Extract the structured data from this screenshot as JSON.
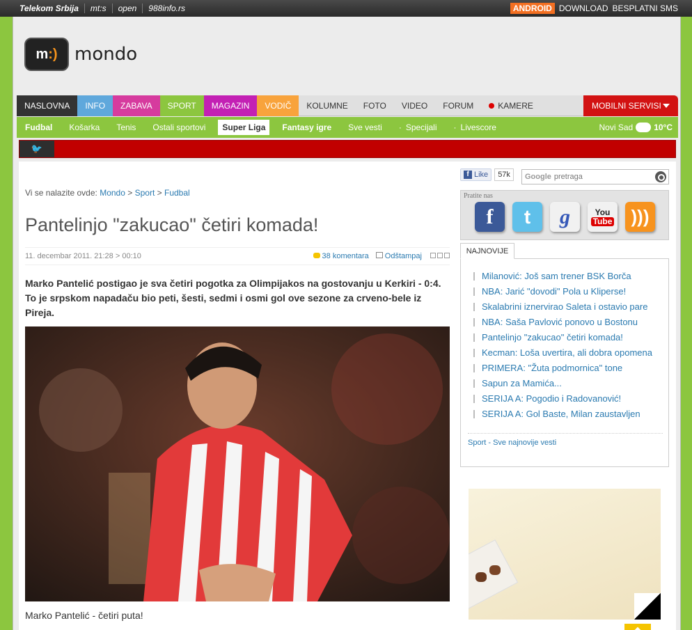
{
  "topbar": {
    "links": [
      "Telekom Srbija",
      "mt:s",
      "open",
      "988info.rs"
    ],
    "android_label": "ANDROID",
    "download_label": "DOWNLOAD",
    "sms_label": "BESPLATNI SMS"
  },
  "logo": {
    "badge_left": "m",
    "badge_right": ":)",
    "word": "mondo"
  },
  "mainnav": {
    "items": [
      "NASLOVNA",
      "INFO",
      "ZABAVA",
      "SPORT",
      "MAGAZIN",
      "VODIČ",
      "KOLUMNE",
      "FOTO",
      "VIDEO",
      "FORUM",
      "KAMERE"
    ],
    "mobile_label": "MOBILNI SERVISI"
  },
  "subnav": {
    "items": [
      "Fudbal",
      "Košarka",
      "Tenis",
      "Ostali sportovi",
      "Super Liga",
      "Fantasy igre",
      "Sve vesti",
      "Specijali",
      "Livescore"
    ],
    "city": "Novi Sad",
    "temperature": "10°C"
  },
  "breadcrumb": {
    "prefix": "Vi se nalazite ovde:",
    "items": [
      "Mondo",
      "Sport",
      "Fudbal"
    ],
    "separator": ">"
  },
  "article": {
    "title": "Pantelinjo \"zakucao\" četiri komada!",
    "date": "11. decembar 2011. 21:28 > 00:10",
    "comments": "38 komentara",
    "print": "Odštampaj",
    "lead": "Marko Pantelić postigao je sva četiri pogotka za Olimpijakos na gostovanju u Kerkiri - 0:4. To je srpskom napadaču bio peti, šesti, sedmi i osmi gol ove sezone za crveno-bele iz Pireja.",
    "caption": "Marko Pantelić - četiri puta!"
  },
  "social": {
    "like_label": "Like",
    "like_count": "57k",
    "search_brand": "Google",
    "search_placeholder": "pretraga",
    "follow_label": "Pratite nas",
    "youtube_top": "You",
    "youtube_bottom": "Tube"
  },
  "news": {
    "tab": "NAJNOVIJE",
    "items": [
      "Milanović: Još sam trener BSK Borča",
      "NBA: Jarić \"dovodi\" Pola u Kliperse!",
      "Skalabrini iznervirao Saleta i ostavio pare",
      "NBA: Saša Pavlović ponovo u Bostonu",
      "Pantelinjo \"zakucao\" četiri komada!",
      "Kecman: Loša uvertira, ali dobra opomena",
      "PRIMERA: \"Žuta podmornica\" tone",
      "Sapun za Mamića...",
      "SERIJA A: Pogodio i Radovanović!",
      "SERIJA A: Gol Baste, Milan zaustavljen"
    ],
    "more": "Sport - Sve najnovije vesti"
  }
}
